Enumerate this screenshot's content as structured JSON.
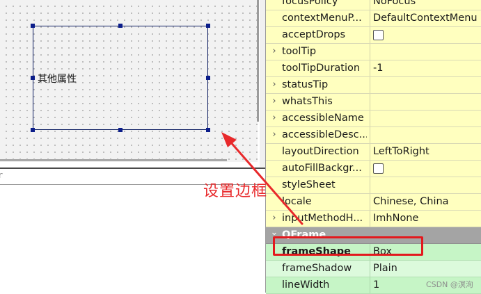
{
  "canvas": {
    "frame_label": "其他属性"
  },
  "edit_pane": {
    "header_text": "r"
  },
  "annotation": {
    "text": "设置边框",
    "color": "#e8292b"
  },
  "properties": [
    {
      "name": "focusPolicy",
      "value": "NoFocus",
      "type": "text",
      "expandable": false,
      "style": "yellow"
    },
    {
      "name": "contextMenuP...",
      "value": "DefaultContextMenu",
      "type": "text",
      "expandable": false,
      "style": "yellow"
    },
    {
      "name": "acceptDrops",
      "value": "",
      "type": "checkbox",
      "expandable": false,
      "style": "yellow"
    },
    {
      "name": "toolTip",
      "value": "",
      "type": "text",
      "expandable": true,
      "style": "yellow"
    },
    {
      "name": "toolTipDuration",
      "value": "-1",
      "type": "text",
      "expandable": false,
      "style": "yellow"
    },
    {
      "name": "statusTip",
      "value": "",
      "type": "text",
      "expandable": true,
      "style": "yellow"
    },
    {
      "name": "whatsThis",
      "value": "",
      "type": "text",
      "expandable": true,
      "style": "yellow"
    },
    {
      "name": "accessibleName",
      "value": "",
      "type": "text",
      "expandable": true,
      "style": "yellow"
    },
    {
      "name": "accessibleDesc...",
      "value": "",
      "type": "text",
      "expandable": true,
      "style": "yellow"
    },
    {
      "name": "layoutDirection",
      "value": "LeftToRight",
      "type": "text",
      "expandable": false,
      "style": "yellow"
    },
    {
      "name": "autoFillBackgr...",
      "value": "",
      "type": "checkbox",
      "expandable": false,
      "style": "yellow"
    },
    {
      "name": "styleSheet",
      "value": "",
      "type": "text",
      "expandable": false,
      "style": "yellow"
    },
    {
      "name": "locale",
      "value": "Chinese, China",
      "type": "text",
      "expandable": false,
      "style": "yellow"
    },
    {
      "name": "inputMethodH...",
      "value": "ImhNone",
      "type": "text",
      "expandable": true,
      "style": "yellow"
    },
    {
      "name": "QFrame",
      "value": "",
      "type": "section",
      "expandable": true,
      "style": "section"
    },
    {
      "name": "frameShape",
      "value": "Box",
      "type": "text",
      "expandable": false,
      "style": "green",
      "bold": true
    },
    {
      "name": "frameShadow",
      "value": "Plain",
      "type": "text",
      "expandable": false,
      "style": "green-alt"
    },
    {
      "name": "lineWidth",
      "value": "1",
      "type": "text",
      "expandable": false,
      "style": "green"
    }
  ],
  "watermark": "CSDN @溟洵"
}
